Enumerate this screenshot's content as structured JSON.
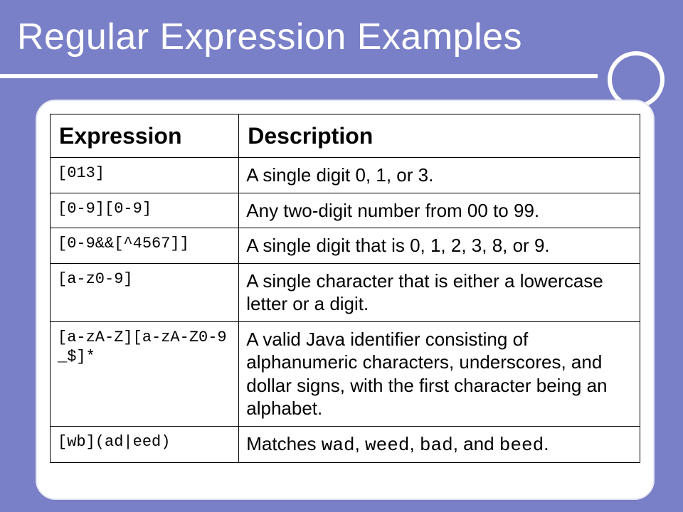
{
  "title": "Regular Expression Examples",
  "table": {
    "headers": {
      "expression": "Expression",
      "description": "Description"
    },
    "rows": [
      {
        "expression": "[013]",
        "description": "A single digit 0, 1, or 3."
      },
      {
        "expression": "[0-9][0-9]",
        "description": "Any two-digit number from 00 to 99."
      },
      {
        "expression": "[0-9&&[^4567]]",
        "description": "A single digit that is 0, 1, 2, 3, 8, or 9."
      },
      {
        "expression": "[a-z0-9]",
        "description": "A single character that is either a lowercase letter or a digit."
      },
      {
        "expression": "[a-zA-Z][a-zA-Z0-9_$]*",
        "description": "A valid Java identifier consisting of alphanumeric characters, underscores, and dollar signs, with the first character being an alphabet."
      },
      {
        "expression": "[wb](ad|eed)",
        "description_parts": [
          "Matches ",
          "wad",
          ", ",
          "weed",
          ", ",
          "bad",
          ", and ",
          "beed",
          "."
        ]
      }
    ]
  }
}
